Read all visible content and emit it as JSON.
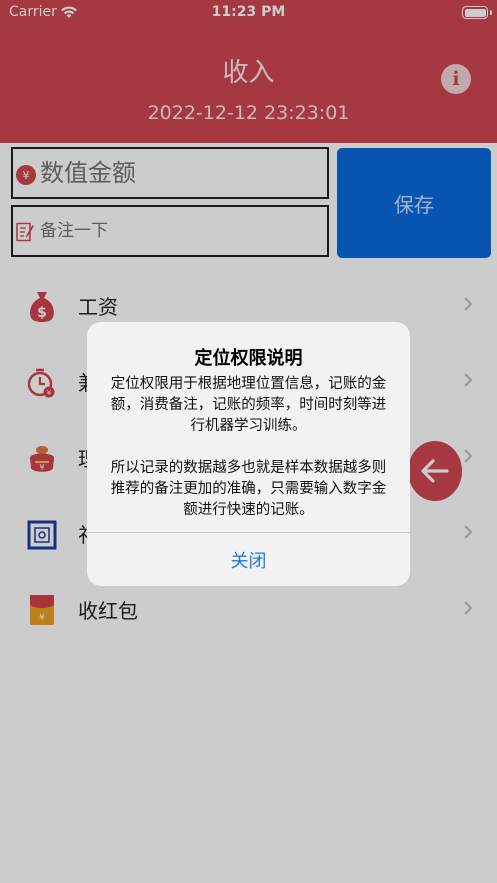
{
  "status_bar": {
    "carrier": "Carrier",
    "time": "11:23 PM"
  },
  "header": {
    "title": "收入",
    "datetime": "2022-12-12 23:23:01",
    "info_icon": "info-icon"
  },
  "form": {
    "amount_placeholder": "数值金额",
    "amount_icon_glyph": "¥",
    "note_placeholder": "备注一下",
    "save_label": "保存"
  },
  "categories": [
    {
      "label": "工资",
      "icon": "money-bag-icon"
    },
    {
      "label": "兼",
      "icon": "timer-coin-icon"
    },
    {
      "label": "理",
      "icon": "money-pot-icon"
    },
    {
      "label": "礼",
      "icon": "gift-box-icon"
    },
    {
      "label": "收红包",
      "icon": "red-envelope-icon"
    }
  ],
  "dialog": {
    "title": "定位权限说明",
    "paragraph1": "定位权限用于根据地理位置信息，记账的金额，消费备注，记账的频率，时间时刻等进行机器学习训练。",
    "paragraph2": "所以记录的数据越多也就是样本数据越多则推荐的备注更加的准确，只需要输入数字金额进行快速的记账。",
    "close_label": "关闭"
  },
  "colors": {
    "header_red": "#cf4650",
    "save_blue": "#0a6ae0",
    "link_blue": "#1a7bea"
  }
}
